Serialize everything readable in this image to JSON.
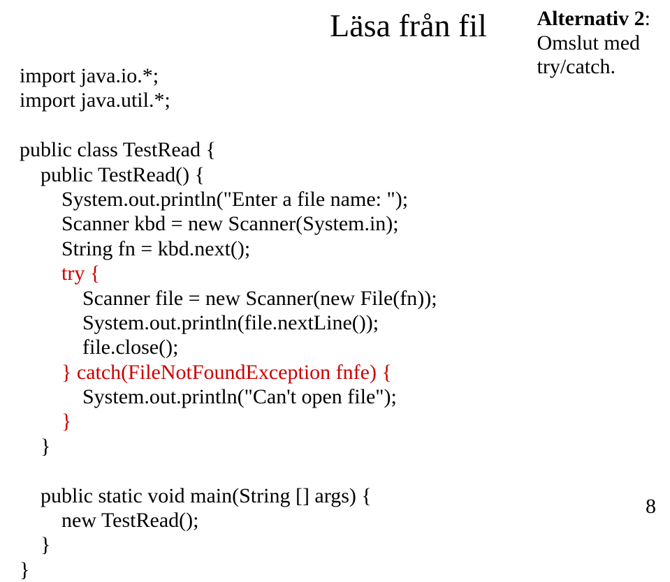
{
  "title": "Läsa från fil",
  "note": {
    "heading_bold": "Alternativ 2",
    "heading_rest": ":",
    "line2": "Omslut med",
    "line3": "try/catch."
  },
  "code": {
    "l1": "import java.io.*;",
    "l2": "import java.util.*;",
    "l3": "",
    "l4": "public class TestRead {",
    "l5": "    public TestRead() {",
    "l6": "        System.out.println(\"Enter a file name: \");",
    "l7": "        Scanner kbd = new Scanner(System.in);",
    "l8": "        String fn = kbd.next();",
    "l9a": "        ",
    "l9b": "try {",
    "l10": "            Scanner file = new Scanner(new File(fn));",
    "l11": "            System.out.println(file.nextLine());",
    "l12": "            file.close();",
    "l13a": "        ",
    "l13b": "} catch(FileNotFoundException fnfe) {",
    "l14": "            System.out.println(\"Can't open file\");",
    "l15a": "        ",
    "l15b": "}",
    "l16": "    }",
    "l17": "",
    "l18": "    public static void main(String [] args) {",
    "l19": "        new TestRead();",
    "l20": "    }",
    "l21": "}"
  },
  "pagenum": "8"
}
